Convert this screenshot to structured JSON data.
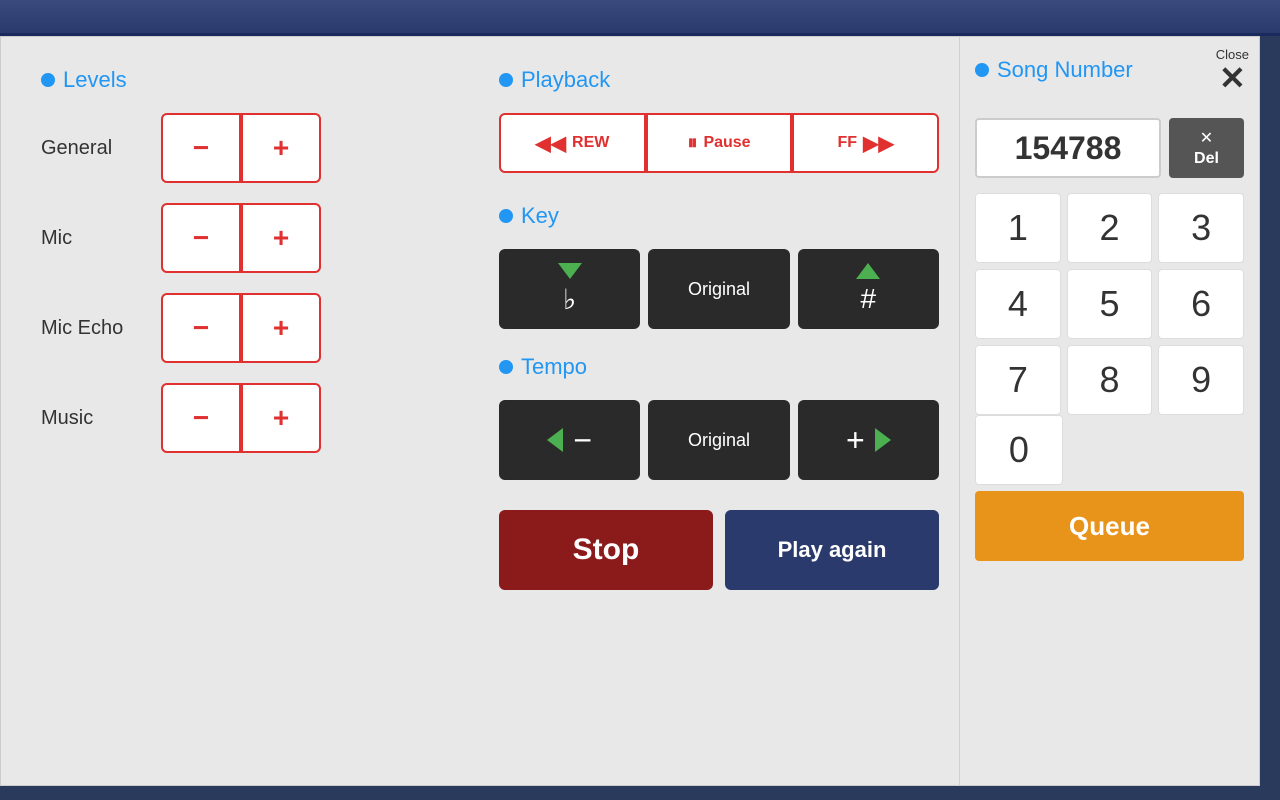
{
  "topbar": {},
  "modal": {
    "close_label": "Close",
    "close_x": "✕"
  },
  "levels": {
    "title": "Levels",
    "general_label": "General",
    "mic_label": "Mic",
    "mic_echo_label": "Mic Echo",
    "music_label": "Music",
    "minus_label": "−",
    "plus_label": "+"
  },
  "playback": {
    "title": "Playback",
    "rew_label": "REW",
    "pause_label": "Pause",
    "ff_label": "FF"
  },
  "key": {
    "title": "Key",
    "flat_label": "♭",
    "original_label": "Original",
    "sharp_label": "#"
  },
  "tempo": {
    "title": "Tempo",
    "minus_label": "−",
    "original_label": "Original",
    "plus_label": "+"
  },
  "actions": {
    "stop_label": "Stop",
    "play_again_label": "Play again"
  },
  "song_number": {
    "title": "Song Number",
    "value": "154788",
    "del_x": "✕",
    "del_label": "Del",
    "queue_label": "Queue",
    "numpad": [
      "1",
      "2",
      "3",
      "4",
      "5",
      "6",
      "7",
      "8",
      "9",
      "0"
    ]
  }
}
